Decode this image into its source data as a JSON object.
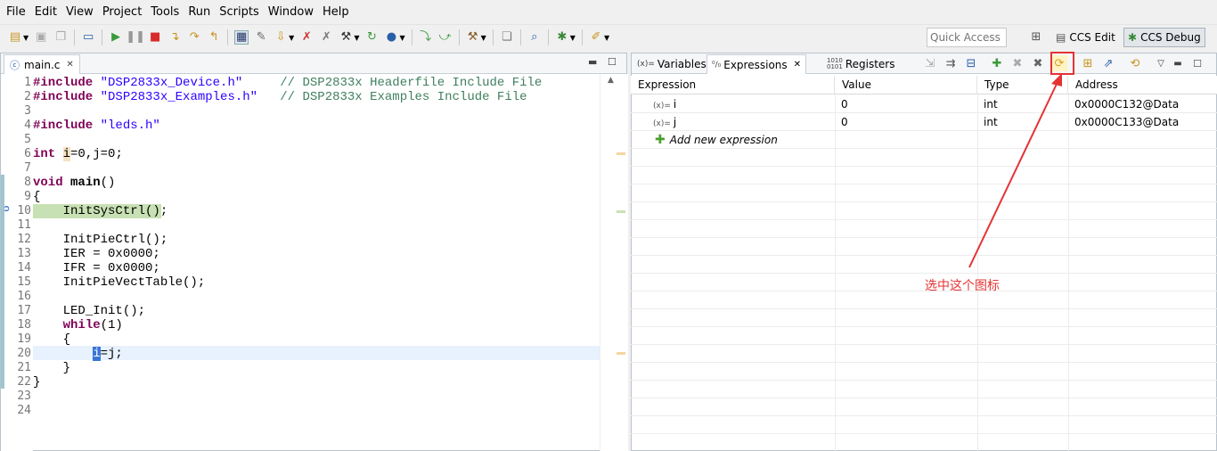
{
  "menu": [
    "File",
    "Edit",
    "View",
    "Project",
    "Tools",
    "Run",
    "Scripts",
    "Window",
    "Help"
  ],
  "toolbar": {
    "quick_access_placeholder": "Quick Access",
    "persp_edit": "CCS Edit",
    "persp_debug": "CCS Debug"
  },
  "editor": {
    "tab": "main.c",
    "lines": [
      "1",
      "2",
      "3",
      "4",
      "5",
      "6",
      "7",
      "8",
      "9",
      "10",
      "11",
      "12",
      "13",
      "14",
      "15",
      "16",
      "17",
      "18",
      "19",
      "20",
      "21",
      "22",
      "23",
      "24"
    ],
    "code": {
      "l1_kw": "#include",
      "l1_str": "\"DSP2833x_Device.h\"",
      "l1_cmt": "// DSP2833x Headerfile Include File",
      "l2_kw": "#include",
      "l2_str": "\"DSP2833x_Examples.h\"",
      "l2_cmt": "// DSP2833x Examples Include File",
      "l4_kw": "#include",
      "l4_str": "\"leds.h\"",
      "l6_kw": "int",
      "l6_var": "i",
      "l6_rest": "=0,j=0;",
      "l8_kw": "void",
      "l8_fn": "main",
      "l8_rest": "()",
      "l9": "{",
      "l10": "InitSysCtrl();",
      "l12": "InitPieCtrl();",
      "l13": "IER = 0x0000;",
      "l14": "IFR = 0x0000;",
      "l15": "InitPieVectTable();",
      "l17": "LED_Init();",
      "l18_kw": "while",
      "l18_rest": "(1)",
      "l19": "{",
      "l20_var": "i",
      "l20_rest": "=j;",
      "l21": "}",
      "l22": "}"
    }
  },
  "expressions": {
    "tabs": [
      "Variables",
      "Expressions",
      "Registers"
    ],
    "columns": [
      "Expression",
      "Value",
      "Type",
      "Address"
    ],
    "rows": [
      {
        "expr": "i",
        "value": "0",
        "type": "int",
        "address": "0x0000C132@Data"
      },
      {
        "expr": "j",
        "value": "0",
        "type": "int",
        "address": "0x0000C133@Data"
      }
    ],
    "add_new": "Add new expression"
  },
  "annotation": {
    "text": "选中这个图标",
    "color": "#e53333"
  }
}
